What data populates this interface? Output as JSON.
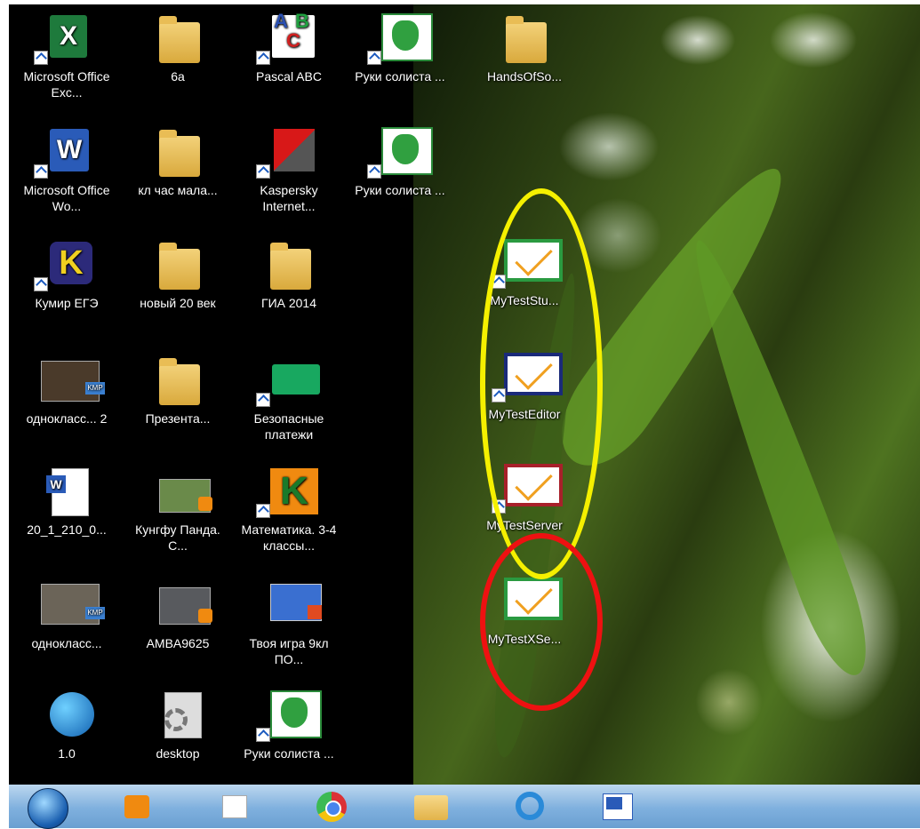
{
  "desktop": {
    "icons": [
      {
        "label": "Microsoft Office Exc..."
      },
      {
        "label": "6a"
      },
      {
        "label": "Pascal ABC"
      },
      {
        "label": "Руки солиста ..."
      },
      {
        "label": "HandsOfSo..."
      },
      {
        "label": "Microsoft Office Wo..."
      },
      {
        "label": "кл час мала..."
      },
      {
        "label": "Kaspersky Internet..."
      },
      {
        "label": "Руки солиста ..."
      },
      {
        "label": "Кумир ЕГЭ"
      },
      {
        "label": "новый 20 век"
      },
      {
        "label": "ГИА 2014"
      },
      {
        "label": "MyTestStu..."
      },
      {
        "label": "однокласс... 2"
      },
      {
        "label": "Презента..."
      },
      {
        "label": "Безопасные платежи"
      },
      {
        "label": "MyTestEditor"
      },
      {
        "label": "20_1_210_0..."
      },
      {
        "label": "Кунгфу Панда. С..."
      },
      {
        "label": "Математика. 3-4 классы..."
      },
      {
        "label": "MyTestServer"
      },
      {
        "label": "однокласс..."
      },
      {
        "label": "AMBA9625"
      },
      {
        "label": "Твоя игра 9кл ПО..."
      },
      {
        "label": "MyTestXSe..."
      },
      {
        "label": "1.0"
      },
      {
        "label": "desktop"
      },
      {
        "label": "Руки солиста ..."
      }
    ],
    "glyphs": {
      "excel": "X",
      "word": "W",
      "abc_a": "A",
      "abc_b": "B",
      "abc_c": "C",
      "kumir": "K",
      "kmp": "KMP",
      "math_k": "K"
    }
  },
  "annotations": {
    "yellow_color": "#f5f000",
    "red_color": "#ee1111"
  },
  "taskbar": {
    "items": [
      {
        "icon": "start-orb-icon"
      },
      {
        "icon": "media-player-icon"
      },
      {
        "icon": "apps-grid-icon"
      },
      {
        "icon": "chrome-icon"
      },
      {
        "icon": "file-explorer-icon"
      },
      {
        "icon": "internet-explorer-icon"
      },
      {
        "icon": "word-icon"
      }
    ]
  }
}
